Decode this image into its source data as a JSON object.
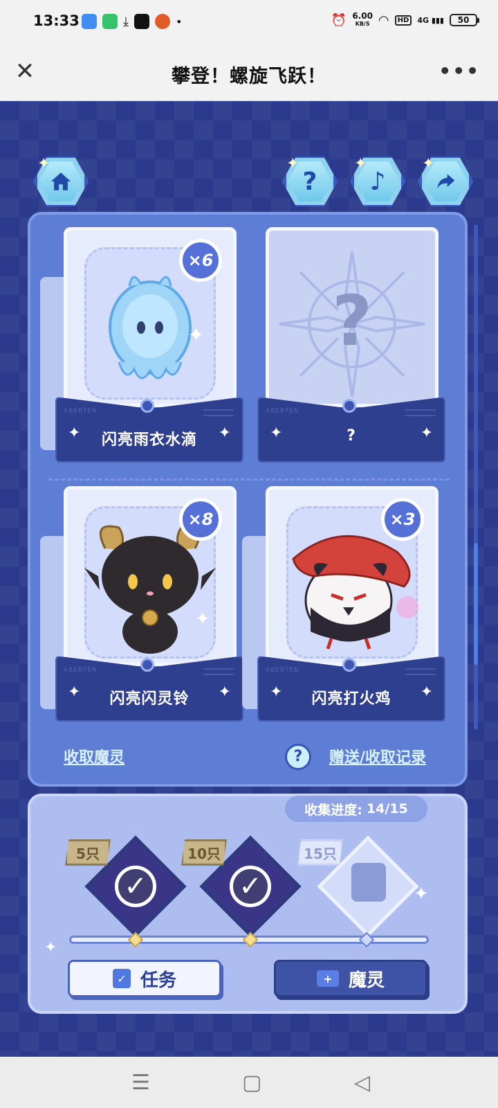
{
  "status_bar": {
    "time": "13:33",
    "net_speed": "6.00",
    "net_unit": "KB/S",
    "hd": "HD",
    "signal": "4G",
    "battery": "50"
  },
  "titlebar": {
    "title": "攀登！螺旋飞跃！"
  },
  "icons": {
    "home": "home-icon",
    "help": "question-icon",
    "music": "music-note-icon",
    "share": "share-arrow-icon"
  },
  "cards": [
    {
      "name": "闪亮雨衣水滴",
      "count": "×6",
      "art": "droplet"
    },
    {
      "name": "?",
      "count": "",
      "art": "unknown"
    },
    {
      "name": "闪亮闪灵铃",
      "count": "×8",
      "art": "goat"
    },
    {
      "name": "闪亮打火鸡",
      "count": "×3",
      "art": "bird"
    }
  ],
  "links": {
    "collect": "收取魔灵",
    "records": "赠送/收取记录",
    "records_icon": "?"
  },
  "progress": {
    "label": "收集进度:",
    "value": "14/15",
    "fraction": 0.9333,
    "milestones": [
      {
        "label": "5只",
        "done": true
      },
      {
        "label": "10只",
        "done": true
      },
      {
        "label": "15只",
        "done": false
      }
    ]
  },
  "buttons": {
    "task": "任务",
    "spirit": "魔灵"
  },
  "colors": {
    "game_bg": "#2b3a8c",
    "panel": "#5e7ed6",
    "accent": "#3653b8"
  }
}
